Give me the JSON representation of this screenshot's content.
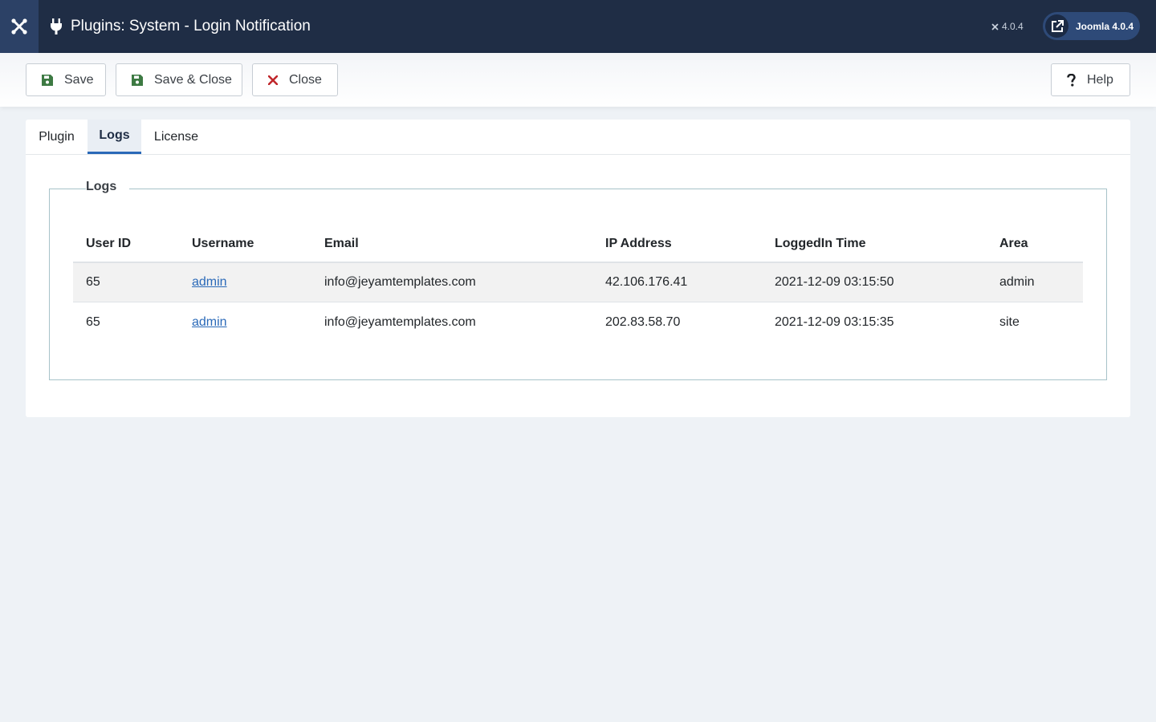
{
  "header": {
    "title": "Plugins: System - Login Notification",
    "version": "4.0.4",
    "site_button": "Joomla 4.0.4"
  },
  "toolbar": {
    "save": "Save",
    "save_close": "Save & Close",
    "close": "Close",
    "help": "Help"
  },
  "tabs": [
    "Plugin",
    "Logs",
    "License"
  ],
  "active_tab": "Logs",
  "logs": {
    "legend": "Logs",
    "columns": [
      "User ID",
      "Username",
      "Email",
      "IP Address",
      "LoggedIn Time",
      "Area"
    ],
    "rows": [
      [
        "65",
        "admin",
        "info@jeyamtemplates.com",
        "42.106.176.41",
        "2021-12-09 03:15:50",
        "admin"
      ],
      [
        "65",
        "admin",
        "info@jeyamtemplates.com",
        "202.83.58.70",
        "2021-12-09 03:15:35",
        "site"
      ]
    ]
  },
  "colors": {
    "header_bg": "#1f2d45",
    "accent": "#2a69b8",
    "save_icon": "#3d7a43",
    "close_icon": "#c0282c"
  }
}
